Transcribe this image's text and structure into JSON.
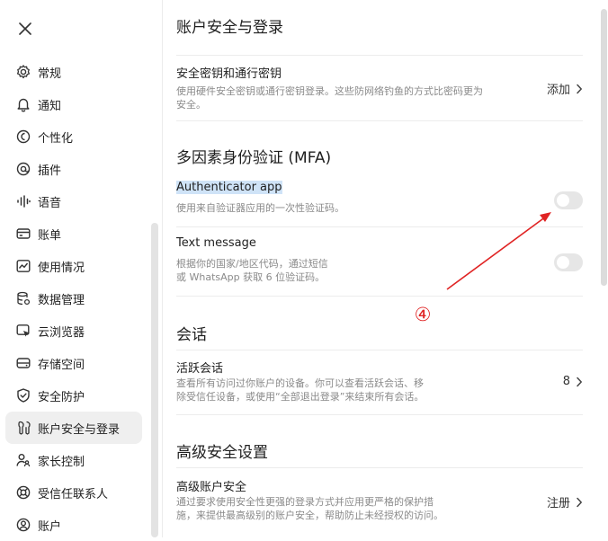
{
  "sidebar": {
    "close_icon": "close-icon",
    "items": [
      {
        "label": "常规",
        "icon": "gear-icon"
      },
      {
        "label": "通知",
        "icon": "bell-icon"
      },
      {
        "label": "个性化",
        "icon": "personalize-icon"
      },
      {
        "label": "插件",
        "icon": "plugin-icon"
      },
      {
        "label": "语音",
        "icon": "voice-wave-icon"
      },
      {
        "label": "账单",
        "icon": "card-icon"
      },
      {
        "label": "使用情况",
        "icon": "chart-icon"
      },
      {
        "label": "数据管理",
        "icon": "database-icon"
      },
      {
        "label": "云浏览器",
        "icon": "cloud-browser-icon"
      },
      {
        "label": "存储空间",
        "icon": "storage-icon"
      },
      {
        "label": "安全防护",
        "icon": "shield-icon"
      },
      {
        "label": "账户安全与登录",
        "icon": "key-icon",
        "active": true
      },
      {
        "label": "家长控制",
        "icon": "family-icon"
      },
      {
        "label": "受信任联系人",
        "icon": "lifebuoy-icon"
      },
      {
        "label": "账户",
        "icon": "account-icon"
      }
    ]
  },
  "main": {
    "section1": {
      "title": "账户安全与登录",
      "passkey": {
        "title": "安全密钥和通行密钥",
        "desc_line1": "使用硬件安全密钥或通行密钥登录。这些防网络钓鱼的方式比密码更为",
        "desc_line2": "安全。",
        "action": "添加"
      }
    },
    "section2": {
      "title": "多因素身份验证 (MFA)",
      "authenticator": {
        "title": "Authenticator app",
        "desc": "使用来自验证器应用的一次性验证码。",
        "enabled": false
      },
      "text_message": {
        "title": "Text message",
        "desc_line1": "根据你的国家/地区代码，通过短信",
        "desc_line2": "或 WhatsApp 获取 6 位验证码。",
        "enabled": false
      }
    },
    "section3": {
      "title": "会话",
      "sessions": {
        "title": "活跃会话",
        "desc_line1": "查看所有访问过你账户的设备。你可以查看活跃会话、移",
        "desc_line2": "除受信任设备，或使用“全部退出登录”来结束所有会话。",
        "count": "8"
      }
    },
    "section4": {
      "title": "高级安全设置",
      "advanced": {
        "title": "高级账户安全",
        "desc_line1": "通过要求使用安全性更强的登录方式并应用更严格的保护措",
        "desc_line2": "施，来提供最高级别的账户安全，帮助防止未经授权的访问。",
        "action": "注册"
      }
    }
  },
  "annotation": {
    "number": "④",
    "color": "#e02424"
  }
}
